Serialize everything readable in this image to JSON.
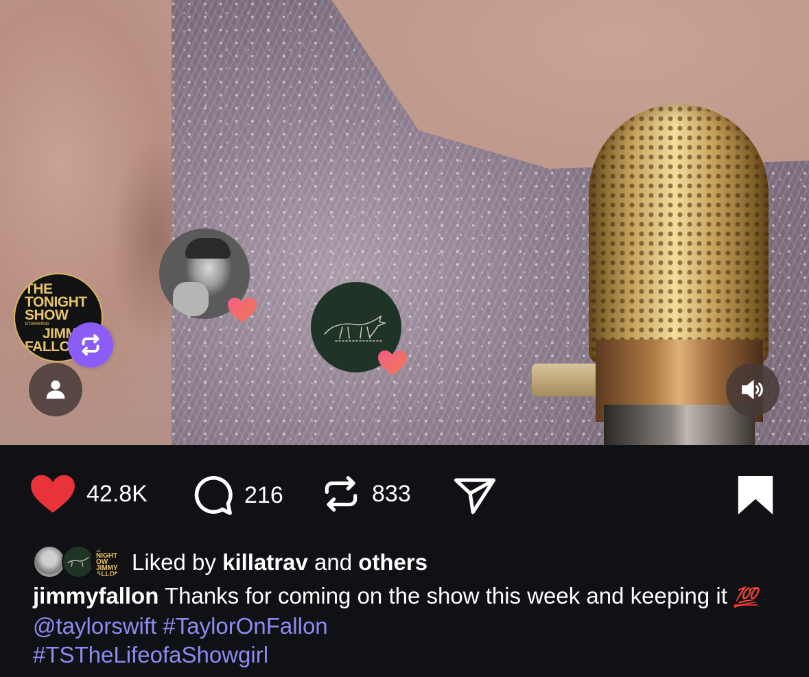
{
  "media": {
    "avatars": [
      {
        "name": "jimmyfallon",
        "badge": "repost",
        "logo_lines": [
          "THE",
          "TONIGHT",
          "SHOW",
          "STARRING",
          "JIMMY",
          "FALLON"
        ]
      },
      {
        "name": "killatrav",
        "badge": "heart"
      },
      {
        "name": "wolf-logo-account",
        "badge": "heart"
      }
    ],
    "profile_icon": "person-icon",
    "sound_icon": "speaker-on-icon"
  },
  "actions": {
    "like_count": "42.8K",
    "comment_count": "216",
    "repost_count": "833",
    "like_color": "#e8333a"
  },
  "likes": {
    "prefix": "Liked by",
    "user": "killatrav",
    "conjunction": "and",
    "others": "others",
    "mini_logo_text": [
      "E",
      "NIGHT",
      "OW",
      "JIMMY",
      "ALLON"
    ]
  },
  "caption": {
    "username": "jimmyfallon",
    "text": "Thanks for coming on the show this week and keeping it",
    "emoji": "💯",
    "mention": "@taylorswift",
    "hashtag1": "#TaylorOnFallon",
    "hashtag2": "#TSTheLifeofaShowgirl"
  },
  "colors": {
    "background": "#0f1115",
    "link": "#8c8cf2",
    "repost_badge": "#8b5cf6"
  }
}
